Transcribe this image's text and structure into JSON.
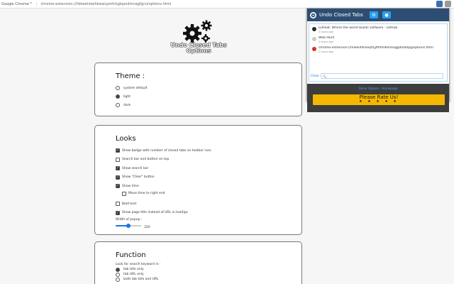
{
  "browser": {
    "brand": "Google Chrome™",
    "url": "chrome-extension://hbkeehdaihbeaicpmfckgkjandmnagfg/ui/options.html"
  },
  "header": {
    "title_line1": "Undo Closed Tabs",
    "title_line2": "Options"
  },
  "theme": {
    "heading": "Theme :",
    "options": [
      "system default",
      "light",
      "dark"
    ],
    "selected": "light"
  },
  "looks": {
    "heading": "Looks",
    "options": [
      {
        "label": "Show badge with number of closed tabs on toolbar icon",
        "checked": true
      },
      {
        "label": "Search bar and button on top",
        "checked": false
      },
      {
        "label": "Show search bar",
        "checked": true
      },
      {
        "label": "Show \"Clear\" button",
        "checked": true
      },
      {
        "label": "Show time",
        "checked": true
      }
    ],
    "sub_option": {
      "label": "Move time to right end",
      "checked": false
    },
    "more_options": [
      {
        "label": "Bold text",
        "checked": false
      },
      {
        "label": "Show page title instead of URL in tooltips",
        "checked": true
      }
    ],
    "popup_width_label": "Width of popup :",
    "popup_width_value": "320",
    "popup_width_fraction": 0.5
  },
  "function": {
    "heading": "Function",
    "search_label": "Look for search keyword in :",
    "options": [
      "tab title only",
      "tab URL only",
      "both tab title and URL"
    ],
    "selected": "tab title only"
  },
  "popup": {
    "title": "Undo Closed Tabs",
    "items": [
      {
        "title": "GitHub: Where the world builds software · GitHub",
        "ago": "2 hours ago",
        "favicon_color": "#24292f"
      },
      {
        "title": "Web Paint",
        "ago": "2 hours ago",
        "favicon_color": "#c9c9c9"
      },
      {
        "title": "chrome-extension://maekdfsoeejfnjjffkfmdkkmoggdodofpg/options.html",
        "ago": "2 hours ago",
        "favicon_color": "#d93025"
      }
    ],
    "clear_label": "Clear",
    "footer_links": "Donor Options · Homepage",
    "rate_label": "Please Rate Us!",
    "stars": "★ ★ ★ ★ ★"
  },
  "colors": {
    "popup_header": "#2d4e72",
    "accent": "#1a73e8",
    "rate_button": "#f5b800"
  }
}
